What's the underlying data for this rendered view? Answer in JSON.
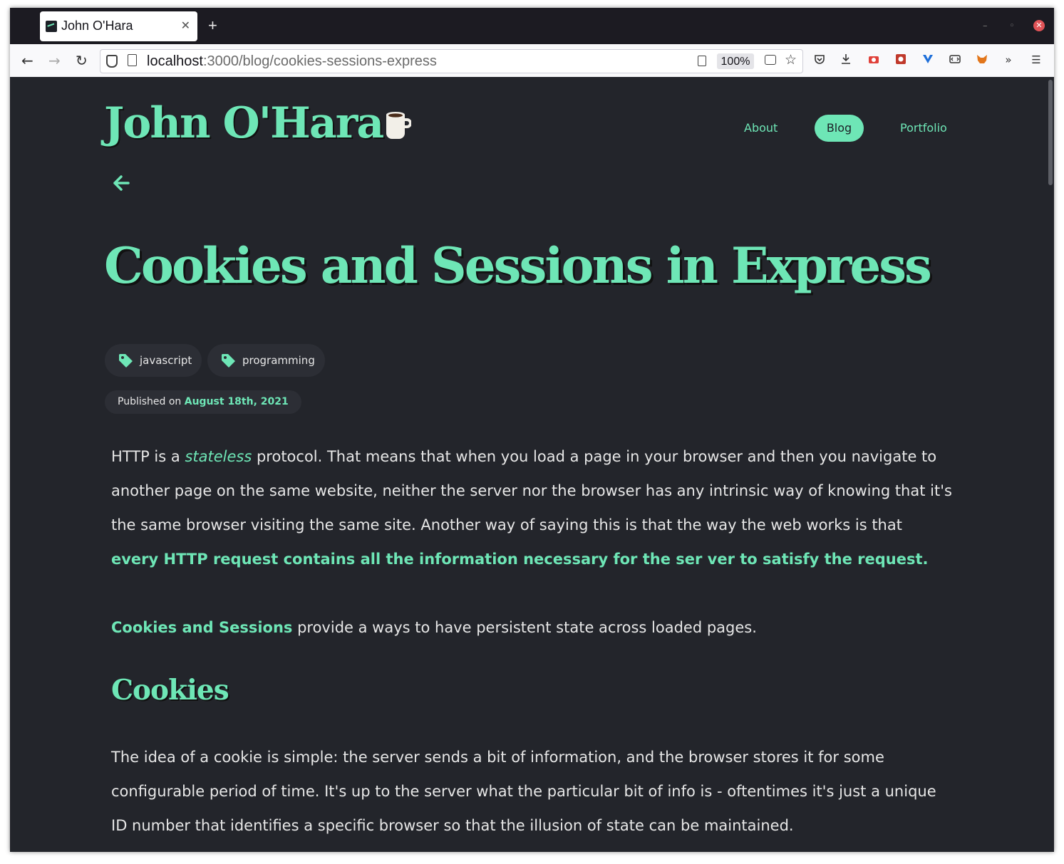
{
  "browser": {
    "tab_title": "John O'Hara",
    "new_tab": "+",
    "url_host": "localhost",
    "url_rest": ":3000/blog/cookies-sessions-express",
    "zoom": "100%"
  },
  "site": {
    "logo": "John O'Hara",
    "nav": {
      "about": "About",
      "blog": "Blog",
      "portfolio": "Portfolio"
    }
  },
  "post": {
    "title": "Cookies and Sessions in Express",
    "tags": [
      "javascript",
      "programming"
    ],
    "published_label": "Published on",
    "published_date": "August 18th, 2021",
    "p1": {
      "a": "HTTP is a",
      "em": "stateless",
      "b": "protocol. That means that when you load a page in your browser and then you navigate to another page on the same website, neither the server nor the browser has any intrinsic way of knowing that it's the same browser visiting the same site. Another way of saying this is that the way the web works is that",
      "strong": "every HTTP request contains all the information necessary for the ser ver to satisfy the request."
    },
    "p2": {
      "strong": "Cookies and Sessions",
      "rest": "provide a ways to have persistent state across loaded pages."
    },
    "h2": "Cookies",
    "p3": "The idea of a cookie is simple: the server sends a bit of information, and the browser stores it for some configurable period of time. It's up to the server what the particular bit of info is - oftentimes it's just a unique ID number that identifies a specific browser so that the illusion of state can be maintained."
  },
  "colors": {
    "accent": "#6ee6b6",
    "background": "#23252b",
    "chip": "#2c2e35",
    "text": "#e6e6e6"
  }
}
